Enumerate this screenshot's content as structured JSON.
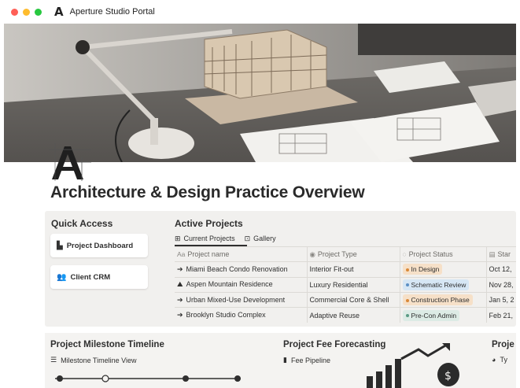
{
  "window": {
    "title": "Aperture Studio Portal",
    "logo": "A",
    "controls": [
      "close",
      "minimize",
      "maximize"
    ]
  },
  "page": {
    "title": "Architecture & Design Practice Overview",
    "logo_icon": "architect-a-logo-icon"
  },
  "quick_access": {
    "heading": "Quick Access",
    "buttons": [
      {
        "label": "Project Dashboard",
        "icon": "dashboard-icon"
      },
      {
        "label": "Client CRM",
        "icon": "people-icon"
      }
    ]
  },
  "active_projects": {
    "heading": "Active Projects",
    "views": [
      {
        "label": "Current Projects",
        "icon": "table-icon",
        "active": true
      },
      {
        "label": "Gallery",
        "icon": "gallery-icon",
        "active": false
      }
    ],
    "columns": [
      {
        "label": "Project name",
        "icon": "Aa"
      },
      {
        "label": "Project Type",
        "icon": "select-icon"
      },
      {
        "label": "Project Status",
        "icon": "status-icon"
      },
      {
        "label": "Star",
        "icon": "calendar-icon"
      }
    ],
    "rows": [
      {
        "name": "Miami Beach Condo Renovation",
        "icon": "arrow-circle-icon",
        "type": "Interior Fit-out",
        "status": "In Design",
        "status_color": "#f6e0c8",
        "status_dot": "#d9893a",
        "start": "Oct 12,"
      },
      {
        "name": "Aspen Mountain Residence",
        "icon": "mountain-icon",
        "type": "Luxury Residential",
        "status": "Schematic Review",
        "status_color": "#d6e6f4",
        "status_dot": "#5c8fc4",
        "start": "Nov 28,"
      },
      {
        "name": "Urban Mixed-Use Development",
        "icon": "arrow-circle-icon",
        "type": "Commercial Core & Shell",
        "status": "Construction Phase",
        "status_color": "#f6e0c8",
        "status_dot": "#d9893a",
        "start": "Jan 5, 2"
      },
      {
        "name": "Brooklyn Studio Complex",
        "icon": "arrow-circle-icon",
        "type": "Adaptive Reuse",
        "status": "Pre-Con Admin",
        "status_color": "#dcebe5",
        "status_dot": "#5a9b84",
        "start": "Feb 21,"
      }
    ]
  },
  "lower": {
    "timeline": {
      "heading": "Project Milestone Timeline",
      "view": "Milestone Timeline View",
      "icon": "list-icon"
    },
    "fees": {
      "heading": "Project Fee Forecasting",
      "view": "Fee Pipeline",
      "icon": "bar-chart-icon"
    },
    "third": {
      "heading": "Proje",
      "view": "Ty",
      "icon": "pie-icon"
    }
  },
  "colors": {
    "close": "#ff5f57",
    "minimize": "#febc2e",
    "maximize": "#28c840",
    "panel": "#f1f0ee"
  }
}
